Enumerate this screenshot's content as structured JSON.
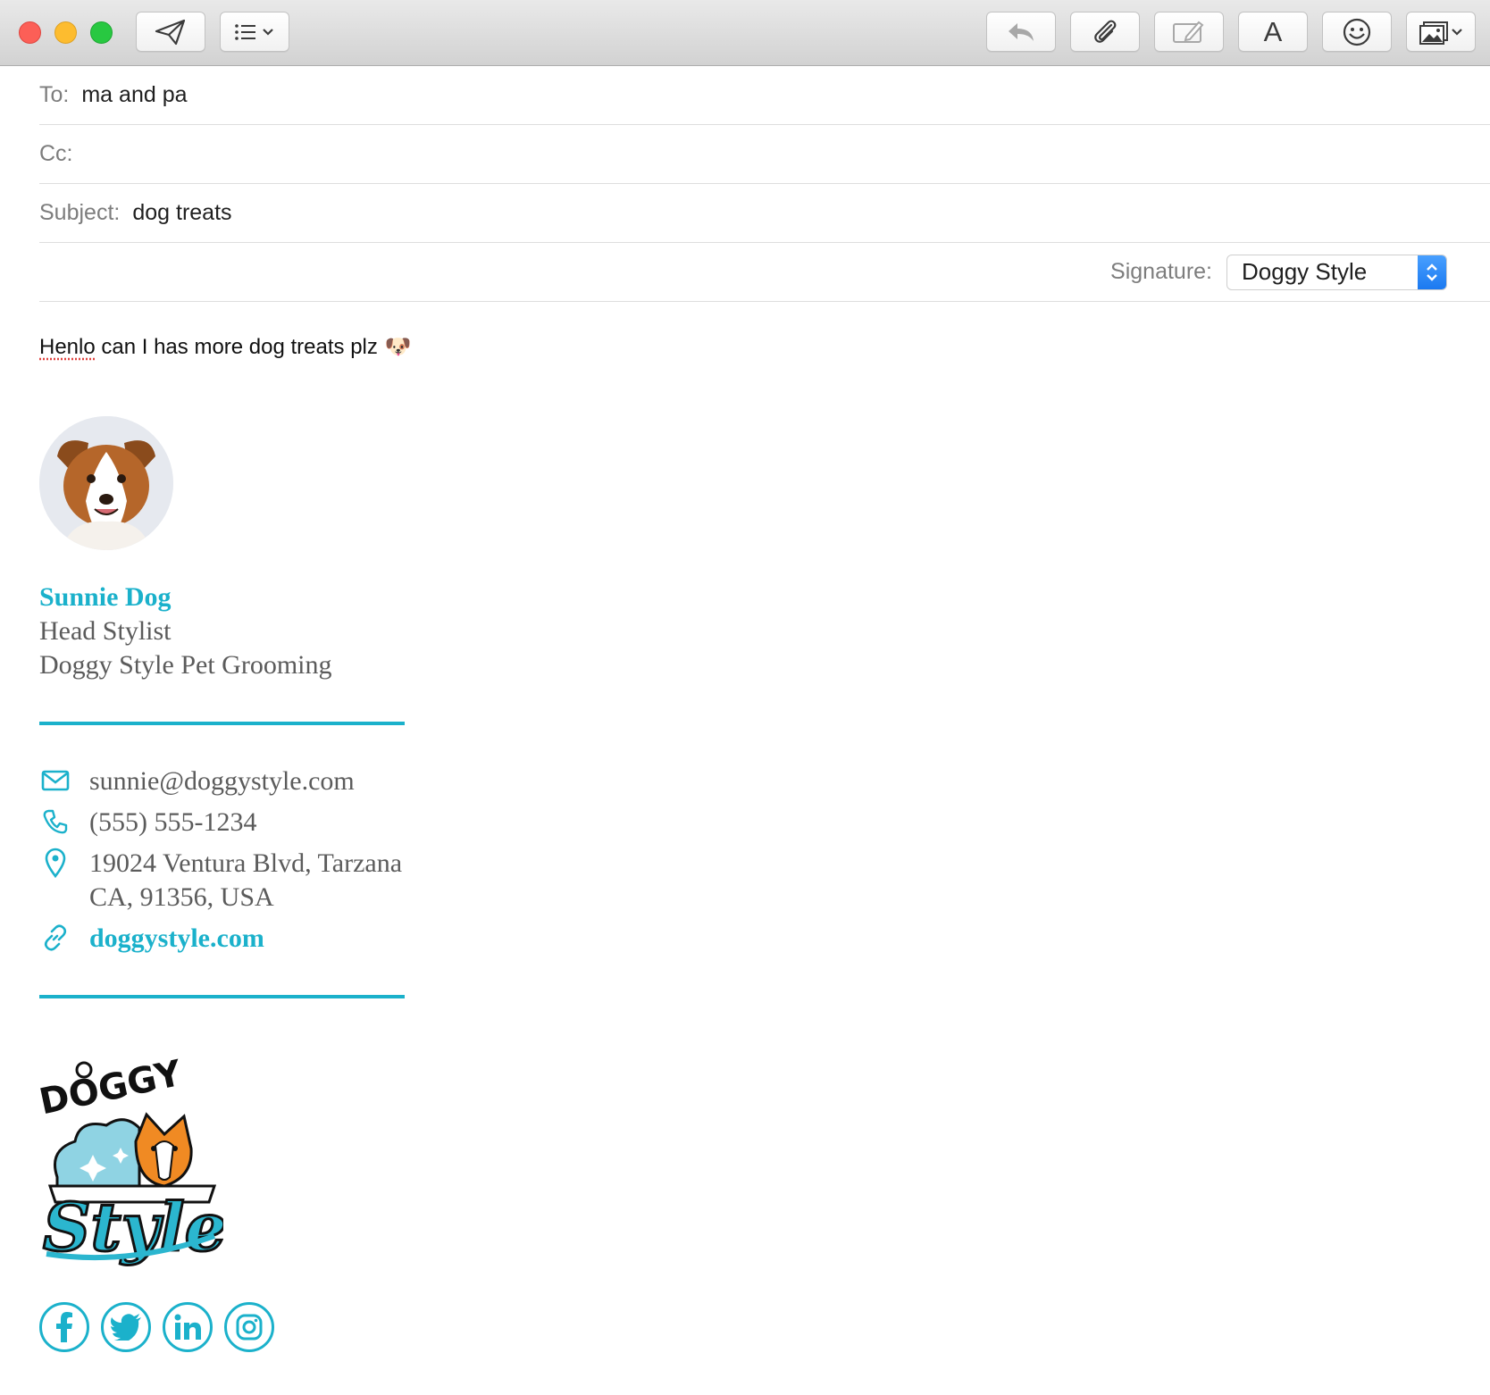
{
  "window": {
    "toolbar": {
      "send": "send-icon",
      "format_list": "list-format-icon",
      "reply": "reply-icon",
      "attach": "paperclip-icon",
      "markup": "markup-icon",
      "font": "A",
      "emoji": "smiley-icon",
      "photo": "photo-browser-icon"
    }
  },
  "header": {
    "to_label": "To:",
    "to_value": "ma and pa",
    "cc_label": "Cc:",
    "cc_value": "",
    "subject_label": "Subject:",
    "subject_value": "dog treats",
    "signature_label": "Signature:",
    "signature_value": "Doggy Style"
  },
  "body": {
    "message_first_word": "Henlo",
    "message_rest": " can I has more dog treats plz",
    "message_emoji": "🐶"
  },
  "signature": {
    "name": "Sunnie Dog",
    "title": "Head Stylist",
    "company": "Doggy Style Pet Grooming",
    "email": "sunnie@doggystyle.com",
    "phone": "(555) 555-1234",
    "address_line1": "19024 Ventura Blvd, Tarzana",
    "address_line2": "CA, 91356, USA",
    "website": "doggystyle.com",
    "logo_text_top": "DOGGY",
    "logo_text_script": "Style",
    "socials": [
      "facebook-icon",
      "twitter-icon",
      "linkedin-icon",
      "instagram-icon"
    ]
  },
  "colors": {
    "accent": "#1bb1cb",
    "signature_text": "#5b5b5b",
    "label_gray": "#7d7d7d",
    "select_blue": "#1a78f0"
  }
}
